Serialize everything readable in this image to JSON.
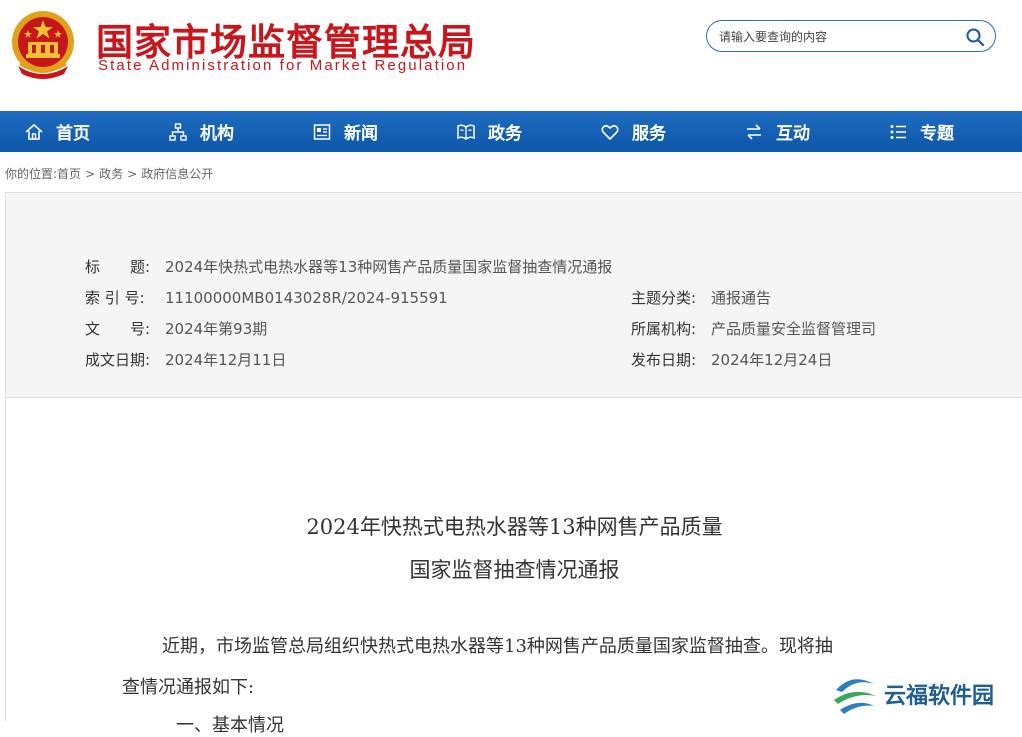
{
  "header": {
    "title_cn": "国家市场监督管理总局",
    "title_en": "State Administration for Market Regulation",
    "search_placeholder": "请输入要查询的内容",
    "search_icon": "search-icon",
    "brand_color": "#c8161d"
  },
  "nav": {
    "bg_color": "#0d56a8",
    "items": [
      {
        "label": "首页",
        "icon": "home-icon"
      },
      {
        "label": "机构",
        "icon": "org-chart-icon"
      },
      {
        "label": "新闻",
        "icon": "newspaper-icon"
      },
      {
        "label": "政务",
        "icon": "book-icon"
      },
      {
        "label": "服务",
        "icon": "heart-icon"
      },
      {
        "label": "互动",
        "icon": "exchange-icon"
      },
      {
        "label": "专题",
        "icon": "list-icon"
      }
    ]
  },
  "breadcrumb": {
    "prefix": "你的位置:",
    "items": [
      "首页",
      "政务",
      "政府信息公开"
    ],
    "sep": ">"
  },
  "meta": {
    "title_label": "标　　题:",
    "title_value": "2024年快热式电热水器等13种网售产品质量国家监督抽查情况通报",
    "index_label": "索 引 号:",
    "index_value": "11100000MB0143028R/2024-915591",
    "category_label": "主题分类:",
    "category_value": "通报通告",
    "docno_label": "文　　号:",
    "docno_value": "2024年第93期",
    "dept_label": "所属机构:",
    "dept_value": "产品质量安全监督管理司",
    "date_label": "成文日期:",
    "date_value": "2024年12月11日",
    "pub_label": "发布日期:",
    "pub_value": "2024年12月24日"
  },
  "article": {
    "title_line1": "2024年快热式电热水器等13种网售产品质量",
    "title_line2": "国家监督抽查情况通报",
    "para1_line1": "近期，市场监管总局组织快热式电热水器等13种网售产品质量国家监督抽查。现将抽",
    "para1_line2": "查情况通报如下:",
    "heading1": "一、基本情况"
  },
  "watermark": {
    "text": "云福软件园"
  }
}
